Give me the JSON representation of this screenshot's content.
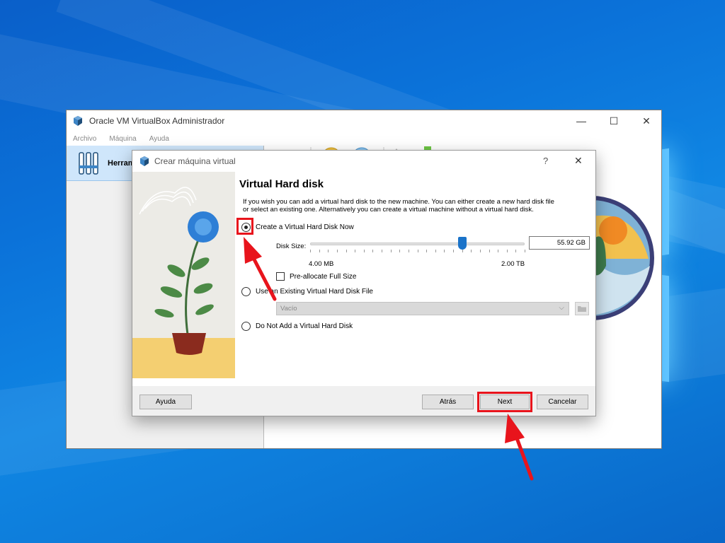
{
  "main_window": {
    "title": "Oracle VM VirtualBox Administrador",
    "menu": [
      "Archivo",
      "Máquina",
      "Ayuda"
    ],
    "sidebar": {
      "tools_label": "Herram"
    },
    "controls": {
      "minimize": "—",
      "maximize": "☐",
      "close": "✕"
    }
  },
  "dialog": {
    "title": "Crear máquina virtual",
    "help_glyph": "?",
    "close_glyph": "✕",
    "heading": "Virtual Hard disk",
    "description": "If you wish you can add a virtual hard disk to the new machine. You can either create a new hard disk file or select an existing one. Alternatively you can create a virtual machine without a virtual hard disk.",
    "options": {
      "create": {
        "label": "Create a Virtual Hard Disk Now",
        "selected": true
      },
      "existing": {
        "label": "Use an Existing Virtual Hard Disk File",
        "selected": false
      },
      "none": {
        "label": "Do Not Add a Virtual Hard Disk",
        "selected": false
      }
    },
    "disk_size": {
      "label": "Disk Size:",
      "value": "55.92 GB",
      "min_label": "4.00 MB",
      "max_label": "2.00 TB",
      "slider_fraction": 0.71
    },
    "preallocate": {
      "label": "Pre-allocate Full Size",
      "checked": false
    },
    "existing_file_select": {
      "value": "Vacío"
    },
    "buttons": {
      "help": "Ayuda",
      "back": "Atrás",
      "next": "Next",
      "cancel": "Cancelar"
    }
  },
  "colors": {
    "highlight": "#e8141c",
    "slider_thumb": "#1a73c9",
    "desktop_blue": "#0b72d9"
  }
}
